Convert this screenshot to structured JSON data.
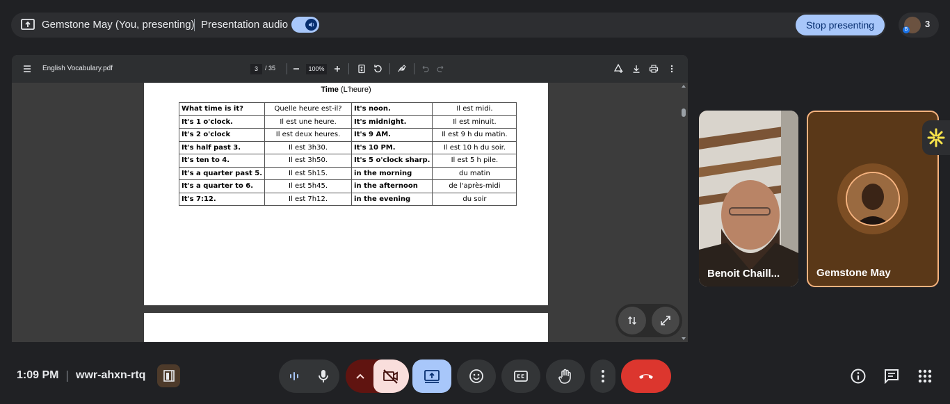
{
  "topbar": {
    "presenter": "Gemstone May (You, presenting)",
    "audio_label": "Presentation audio",
    "stop_label": "Stop presenting",
    "people_count": "3",
    "people_badge": "B"
  },
  "pdf": {
    "filename": "English Vocabulary.pdf",
    "page_current": "3",
    "page_total": "/ 35",
    "zoom": "100%",
    "title_bold": "Time",
    "title_rest": " (L'heure)",
    "rows": [
      [
        "What time is it?",
        "Quelle heure est-il?",
        "It's noon.",
        "Il est midi."
      ],
      [
        "It's 1 o'clock.",
        "Il est une heure.",
        "It's midnight.",
        "Il est minuit."
      ],
      [
        "It's 2 o'clock",
        "Il est deux heures.",
        "It's 9 AM.",
        "Il est 9 h du matin."
      ],
      [
        "It's half past 3.",
        "Il est 3h30.",
        "It's 10 PM.",
        "Il est 10 h du soir."
      ],
      [
        "It's ten to 4.",
        "Il est 3h50.",
        "It's 5 o'clock sharp.",
        "Il est 5 h pile."
      ],
      [
        "It's a quarter past 5.",
        "Il est 5h15.",
        "in the morning",
        "du matin"
      ],
      [
        "It's a quarter to 6.",
        "Il est 5h45.",
        "in the afternoon",
        "de l'après-midi"
      ],
      [
        "It's 7:12.",
        "Il est 7h12.",
        "in the evening",
        "du soir"
      ]
    ]
  },
  "participants": [
    {
      "name": "Benoit Chaill..."
    },
    {
      "name": "Gemstone May"
    }
  ],
  "bottom": {
    "time": "1:09 PM",
    "meeting_code": "wwr-ahxn-rtq"
  },
  "colors": {
    "accent": "#a8c7fa",
    "hangup": "#dc362e",
    "highlight": "#f6b37f"
  }
}
